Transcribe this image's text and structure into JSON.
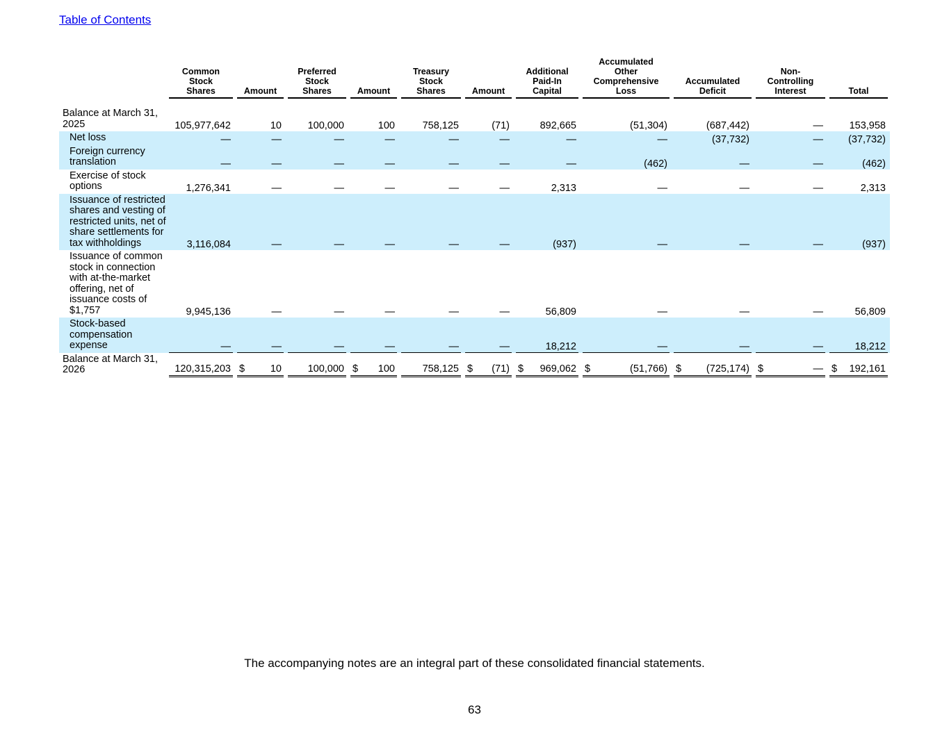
{
  "toc_link": "Table of Contents",
  "headers": [
    [
      "Common",
      "Stock",
      "Shares"
    ],
    [
      "Amount"
    ],
    [
      "Preferred",
      "Stock",
      "Shares"
    ],
    [
      "Amount"
    ],
    [
      "Treasury",
      "Stock",
      "Shares"
    ],
    [
      "Amount"
    ],
    [
      "Additional",
      "Paid-In",
      "Capital"
    ],
    [
      "Accumulated",
      "Other",
      "Comprehensive",
      "Loss"
    ],
    [
      "Accumulated",
      "Deficit"
    ],
    [
      "Non-",
      "Controlling",
      "Interest"
    ],
    [
      "Total"
    ]
  ],
  "rows": [
    {
      "label": "Balance at March 31, 2025",
      "indent": false,
      "shade": false,
      "values": [
        "105,977,642",
        "10",
        "100,000",
        "100",
        "758,125",
        "(71)",
        "892,665",
        "(51,304)",
        "(687,442)",
        "—",
        "153,958"
      ]
    },
    {
      "label": "Net loss",
      "indent": true,
      "shade": true,
      "values": [
        "—",
        "—",
        "—",
        "—",
        "—",
        "—",
        "—",
        "—",
        "(37,732)",
        "—",
        "(37,732)"
      ]
    },
    {
      "label": "Foreign currency translation",
      "indent": true,
      "shade": true,
      "values": [
        "—",
        "—",
        "—",
        "—",
        "—",
        "—",
        "—",
        "(462)",
        "—",
        "—",
        "(462)"
      ]
    },
    {
      "label": "Exercise of stock options",
      "indent": true,
      "shade": false,
      "values": [
        "1,276,341",
        "—",
        "—",
        "—",
        "—",
        "—",
        "2,313",
        "—",
        "—",
        "—",
        "2,313"
      ]
    },
    {
      "label": "Issuance of restricted shares and vesting of restricted units, net of share settlements for tax withholdings",
      "indent": true,
      "shade": true,
      "values": [
        "3,116,084",
        "—",
        "—",
        "—",
        "—",
        "—",
        "(937)",
        "—",
        "—",
        "—",
        "(937)"
      ]
    },
    {
      "label": "Issuance of common stock in connection with at-the-market offering, net of issuance costs of $1,757",
      "indent": true,
      "shade": false,
      "values": [
        "9,945,136",
        "—",
        "—",
        "—",
        "—",
        "—",
        "56,809",
        "—",
        "—",
        "—",
        "56,809"
      ]
    },
    {
      "label": "Stock-based compensation expense",
      "indent": true,
      "shade": true,
      "values": [
        "—",
        "—",
        "—",
        "—",
        "—",
        "—",
        "18,212",
        "—",
        "—",
        "—",
        "18,212"
      ]
    },
    {
      "label": "Balance at March 31, 2026",
      "indent": false,
      "shade": false,
      "total": true,
      "values": [
        "120,315,203",
        "10",
        "100,000",
        "100",
        "758,125",
        "(71)",
        "969,062",
        "(51,766)",
        "(725,174)",
        "—",
        "192,161"
      ]
    }
  ],
  "dollar_sign": "$",
  "dollar_columns": [
    1,
    3,
    5,
    6,
    7,
    8,
    9,
    10
  ],
  "footnote": "The accompanying notes are an integral part of these consolidated financial statements.",
  "page_number": "63"
}
